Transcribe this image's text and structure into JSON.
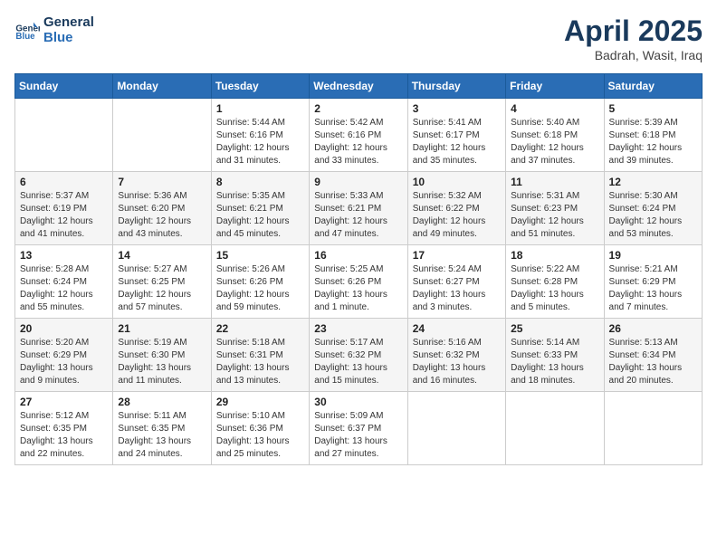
{
  "logo": {
    "line1": "General",
    "line2": "Blue"
  },
  "title": "April 2025",
  "subtitle": "Badrah, Wasit, Iraq",
  "days_of_week": [
    "Sunday",
    "Monday",
    "Tuesday",
    "Wednesday",
    "Thursday",
    "Friday",
    "Saturday"
  ],
  "weeks": [
    [
      {
        "day": "",
        "info": ""
      },
      {
        "day": "",
        "info": ""
      },
      {
        "day": "1",
        "info": "Sunrise: 5:44 AM\nSunset: 6:16 PM\nDaylight: 12 hours\nand 31 minutes."
      },
      {
        "day": "2",
        "info": "Sunrise: 5:42 AM\nSunset: 6:16 PM\nDaylight: 12 hours\nand 33 minutes."
      },
      {
        "day": "3",
        "info": "Sunrise: 5:41 AM\nSunset: 6:17 PM\nDaylight: 12 hours\nand 35 minutes."
      },
      {
        "day": "4",
        "info": "Sunrise: 5:40 AM\nSunset: 6:18 PM\nDaylight: 12 hours\nand 37 minutes."
      },
      {
        "day": "5",
        "info": "Sunrise: 5:39 AM\nSunset: 6:18 PM\nDaylight: 12 hours\nand 39 minutes."
      }
    ],
    [
      {
        "day": "6",
        "info": "Sunrise: 5:37 AM\nSunset: 6:19 PM\nDaylight: 12 hours\nand 41 minutes."
      },
      {
        "day": "7",
        "info": "Sunrise: 5:36 AM\nSunset: 6:20 PM\nDaylight: 12 hours\nand 43 minutes."
      },
      {
        "day": "8",
        "info": "Sunrise: 5:35 AM\nSunset: 6:21 PM\nDaylight: 12 hours\nand 45 minutes."
      },
      {
        "day": "9",
        "info": "Sunrise: 5:33 AM\nSunset: 6:21 PM\nDaylight: 12 hours\nand 47 minutes."
      },
      {
        "day": "10",
        "info": "Sunrise: 5:32 AM\nSunset: 6:22 PM\nDaylight: 12 hours\nand 49 minutes."
      },
      {
        "day": "11",
        "info": "Sunrise: 5:31 AM\nSunset: 6:23 PM\nDaylight: 12 hours\nand 51 minutes."
      },
      {
        "day": "12",
        "info": "Sunrise: 5:30 AM\nSunset: 6:24 PM\nDaylight: 12 hours\nand 53 minutes."
      }
    ],
    [
      {
        "day": "13",
        "info": "Sunrise: 5:28 AM\nSunset: 6:24 PM\nDaylight: 12 hours\nand 55 minutes."
      },
      {
        "day": "14",
        "info": "Sunrise: 5:27 AM\nSunset: 6:25 PM\nDaylight: 12 hours\nand 57 minutes."
      },
      {
        "day": "15",
        "info": "Sunrise: 5:26 AM\nSunset: 6:26 PM\nDaylight: 12 hours\nand 59 minutes."
      },
      {
        "day": "16",
        "info": "Sunrise: 5:25 AM\nSunset: 6:26 PM\nDaylight: 13 hours\nand 1 minute."
      },
      {
        "day": "17",
        "info": "Sunrise: 5:24 AM\nSunset: 6:27 PM\nDaylight: 13 hours\nand 3 minutes."
      },
      {
        "day": "18",
        "info": "Sunrise: 5:22 AM\nSunset: 6:28 PM\nDaylight: 13 hours\nand 5 minutes."
      },
      {
        "day": "19",
        "info": "Sunrise: 5:21 AM\nSunset: 6:29 PM\nDaylight: 13 hours\nand 7 minutes."
      }
    ],
    [
      {
        "day": "20",
        "info": "Sunrise: 5:20 AM\nSunset: 6:29 PM\nDaylight: 13 hours\nand 9 minutes."
      },
      {
        "day": "21",
        "info": "Sunrise: 5:19 AM\nSunset: 6:30 PM\nDaylight: 13 hours\nand 11 minutes."
      },
      {
        "day": "22",
        "info": "Sunrise: 5:18 AM\nSunset: 6:31 PM\nDaylight: 13 hours\nand 13 minutes."
      },
      {
        "day": "23",
        "info": "Sunrise: 5:17 AM\nSunset: 6:32 PM\nDaylight: 13 hours\nand 15 minutes."
      },
      {
        "day": "24",
        "info": "Sunrise: 5:16 AM\nSunset: 6:32 PM\nDaylight: 13 hours\nand 16 minutes."
      },
      {
        "day": "25",
        "info": "Sunrise: 5:14 AM\nSunset: 6:33 PM\nDaylight: 13 hours\nand 18 minutes."
      },
      {
        "day": "26",
        "info": "Sunrise: 5:13 AM\nSunset: 6:34 PM\nDaylight: 13 hours\nand 20 minutes."
      }
    ],
    [
      {
        "day": "27",
        "info": "Sunrise: 5:12 AM\nSunset: 6:35 PM\nDaylight: 13 hours\nand 22 minutes."
      },
      {
        "day": "28",
        "info": "Sunrise: 5:11 AM\nSunset: 6:35 PM\nDaylight: 13 hours\nand 24 minutes."
      },
      {
        "day": "29",
        "info": "Sunrise: 5:10 AM\nSunset: 6:36 PM\nDaylight: 13 hours\nand 25 minutes."
      },
      {
        "day": "30",
        "info": "Sunrise: 5:09 AM\nSunset: 6:37 PM\nDaylight: 13 hours\nand 27 minutes."
      },
      {
        "day": "",
        "info": ""
      },
      {
        "day": "",
        "info": ""
      },
      {
        "day": "",
        "info": ""
      }
    ]
  ]
}
